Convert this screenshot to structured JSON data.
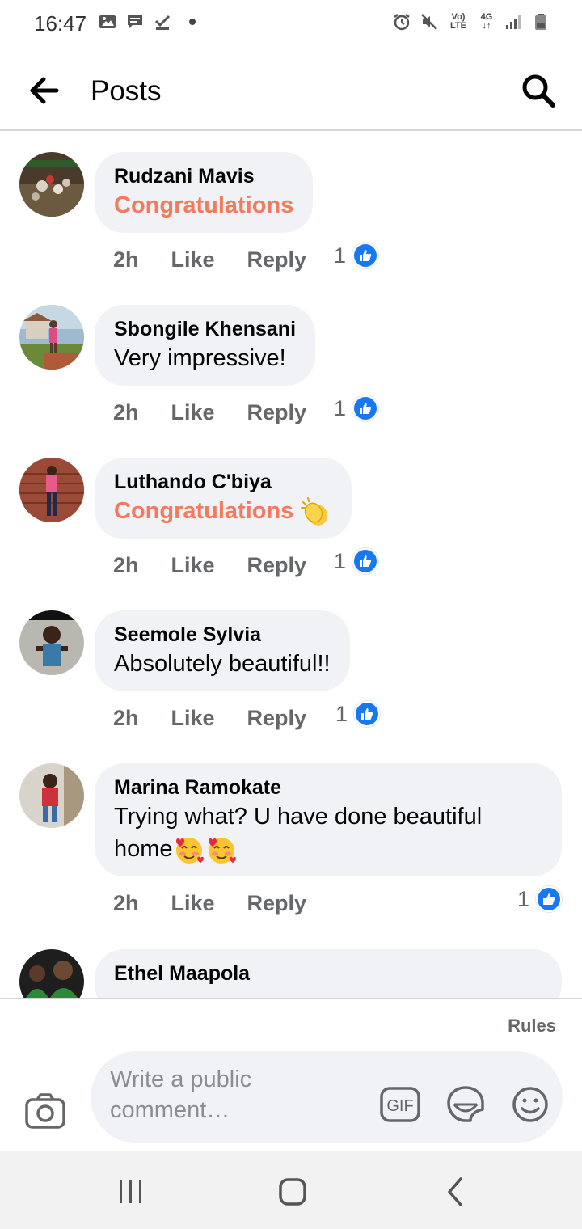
{
  "status_bar": {
    "time": "16:47",
    "left_icons": [
      "image-icon",
      "message-icon",
      "download-done-icon",
      "dot-icon"
    ],
    "right_icons": [
      "alarm-icon",
      "mute-icon",
      "volte-icon",
      "4g-icon",
      "signal-icon",
      "battery-icon"
    ],
    "volte_label": "Vo) LTE",
    "network_label": "4G"
  },
  "header": {
    "title": "Posts",
    "back_icon": "arrow-left-icon",
    "search_icon": "search-icon"
  },
  "comments": [
    {
      "name": "Rudzani Mavis",
      "text": "Congratulations",
      "emphasized": true,
      "emoji": "",
      "time": "2h",
      "like_label": "Like",
      "reply_label": "Reply",
      "reactions": "1"
    },
    {
      "name": "Sbongile Khensani",
      "text": "Very impressive!",
      "emphasized": false,
      "emoji": "",
      "time": "2h",
      "like_label": "Like",
      "reply_label": "Reply",
      "reactions": "1"
    },
    {
      "name": "Luthando C'biya",
      "text": "Congratulations",
      "emphasized": true,
      "emoji": "clapping-hands",
      "time": "2h",
      "like_label": "Like",
      "reply_label": "Reply",
      "reactions": "1"
    },
    {
      "name": "Seemole Sylvia",
      "text": "Absolutely beautiful!!",
      "emphasized": false,
      "emoji": "",
      "time": "2h",
      "like_label": "Like",
      "reply_label": "Reply",
      "reactions": "1"
    },
    {
      "name": "Marina Ramokate",
      "text_line1": "Trying  what? U have done beautiful",
      "text_line2": "home",
      "emphasized": false,
      "emoji": "smiling-face-with-hearts",
      "time": "2h",
      "like_label": "Like",
      "reply_label": "Reply",
      "reactions": "1"
    },
    {
      "name": "Ethel Maapola"
    }
  ],
  "composer": {
    "rules_label": "Rules",
    "placeholder": "Write a public comment…",
    "gif_label": "GIF",
    "camera_icon": "camera-icon",
    "sticker_icon": "sticker-icon",
    "emoji_icon": "smiley-icon"
  },
  "colors": {
    "accent_orange": "#f07b5e",
    "like_blue": "#1877f2",
    "bubble_bg": "#f0f2f5",
    "secondary_text": "#65676b"
  },
  "nav_bar": {
    "icons": [
      "recent-apps-icon",
      "home-icon",
      "back-icon"
    ]
  }
}
